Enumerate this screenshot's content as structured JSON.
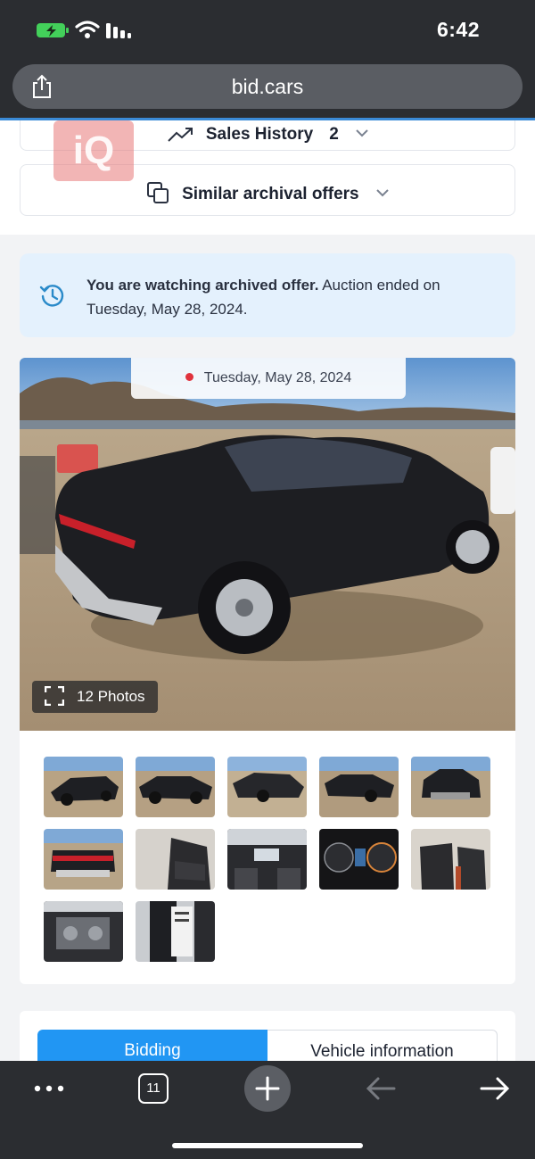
{
  "status_bar": {
    "time": "6:42"
  },
  "browser": {
    "url": "bid.cars",
    "tab_count": "11"
  },
  "sections": {
    "sales_history_label": "Sales History",
    "sales_history_count": "2",
    "similar_label": "Similar archival offers"
  },
  "watermark": "iQ",
  "notice": {
    "bold": "You are watching archived offer.",
    "rest": " Auction ended on Tuesday, May 28, 2024."
  },
  "gallery": {
    "date": "Tuesday, May 28, 2024",
    "photos_label": "12 Photos",
    "thumbnail_count": 12
  },
  "tabs": [
    {
      "label": "Bidding",
      "active": true
    },
    {
      "label": "Vehicle information",
      "active": false
    }
  ],
  "colors": {
    "accent": "#2196f3",
    "notice_bg": "#e4f1fd",
    "dot": "#e0323c"
  }
}
